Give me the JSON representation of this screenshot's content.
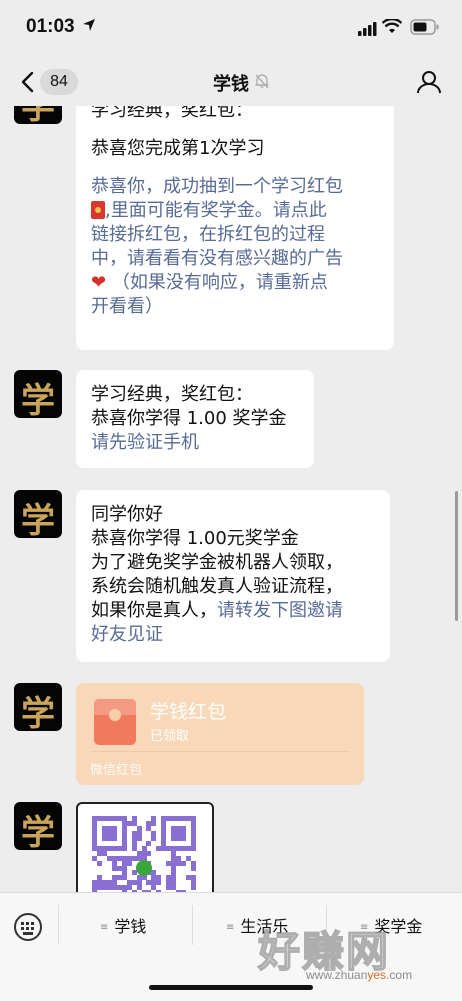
{
  "status_bar": {
    "time": "01:03"
  },
  "nav": {
    "back_count": "84",
    "title": "学钱"
  },
  "messages": [
    {
      "cut_line": "学习经典，奖红包：",
      "line1": "恭喜您完成第1次学习",
      "link_lines": [
        "恭喜你，成功抽到一个学习红包",
        ",里面可能有奖学金。请点此",
        "链接拆红包，在拆红包的过程",
        "中，请看看有没有感兴趣的广告",
        "（如果没有响应，请重新点",
        "开看看）"
      ]
    },
    {
      "line1": "学习经典，奖红包：",
      "line2": "恭喜你学得 1.00 奖学金",
      "link": "请先验证手机"
    },
    {
      "line1": "同学你好",
      "line2": "恭喜你学得 1.00元奖学金",
      "line3": "为了避免奖学金被机器人领取，",
      "line4": "系统会随机触发真人验证流程，",
      "line5_plain": "如果你是真人，",
      "line5_link": "请转发下图邀请",
      "line6_link": "好友见证"
    }
  ],
  "avatar_char": "学",
  "red_packet": {
    "name": "学钱红包",
    "status": "已领取",
    "footer": "微信红包"
  },
  "bottom_menu": [
    "学钱",
    "生活乐",
    "奖学金"
  ],
  "watermark": {
    "big": "好赚网",
    "small_a": "www.zhuan",
    "small_b": "yes",
    "small_c": ".com"
  },
  "colors": {
    "link": "#576b95",
    "background": "#ededed",
    "red_packet": "#f8d8b8"
  }
}
